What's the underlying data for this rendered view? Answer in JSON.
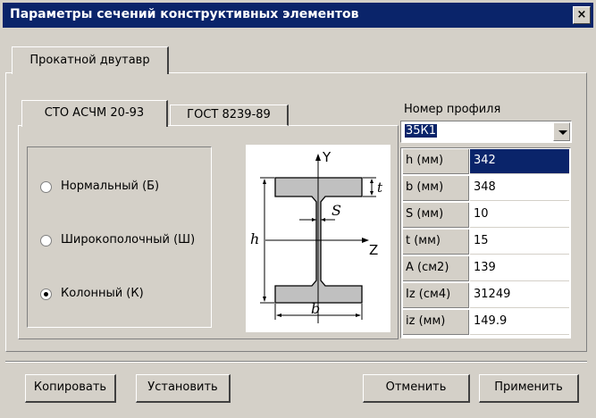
{
  "window": {
    "title": "Параметры  сечений конструктивных элементов",
    "close_label": "×"
  },
  "outer_tab": {
    "label": "Прокатной двутавр"
  },
  "inner_tabs": [
    {
      "label": "СТО АСЧМ 20-93",
      "selected": true
    },
    {
      "label": "ГОСТ 8239-89",
      "selected": false
    }
  ],
  "radio_options": [
    {
      "label": "Нормальный (Б)",
      "checked": false
    },
    {
      "label": "Широкополочный (Ш)",
      "checked": false
    },
    {
      "label": "Колонный (К)",
      "checked": true
    }
  ],
  "diagram": {
    "y_axis": "Y",
    "z_axis": "Z",
    "t_label": "t",
    "s_label": "S",
    "h_label": "h",
    "b_label": "b"
  },
  "profile": {
    "label": "Номер профиля",
    "value": "35К1"
  },
  "params": [
    {
      "name": "h (мм)",
      "value": "342"
    },
    {
      "name": "b (мм)",
      "value": "348"
    },
    {
      "name": "S (мм)",
      "value": "10"
    },
    {
      "name": "t (мм)",
      "value": "15"
    },
    {
      "name": "A (см2)",
      "value": "139"
    },
    {
      "name": "Iz (см4)",
      "value": "31249"
    },
    {
      "name": "iz (мм)",
      "value": "149.9"
    }
  ],
  "buttons": {
    "copy": "Копировать",
    "set": "Установить",
    "cancel": "Отменить",
    "apply": "Применить"
  },
  "colors": {
    "titlebar": "#0a246a",
    "face": "#d4d0c8",
    "selection": "#0a246a",
    "shape_fill": "#c0c0c0"
  }
}
